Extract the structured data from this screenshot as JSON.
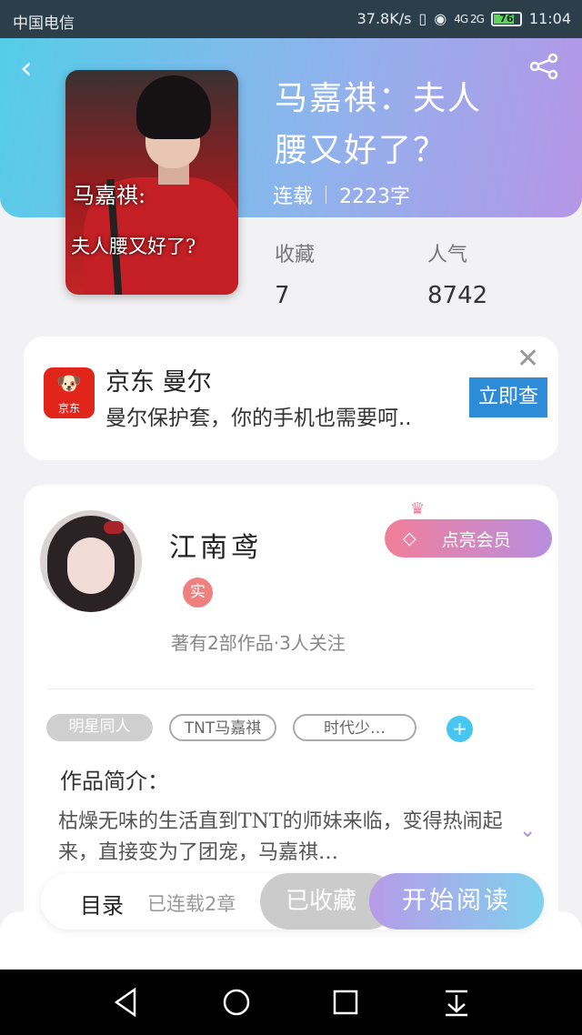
{
  "status_bar": {
    "carrier": "中国电信",
    "net_speed": "37.8K/s",
    "signal": "4G 2G",
    "battery": "76",
    "time": "11:04"
  },
  "header": {
    "gradient": [
      "#55cde8",
      "#b596e6"
    ]
  },
  "book": {
    "title_line1": "马嘉祺：夫人",
    "title_line2": "腰又好了？",
    "status": "连载",
    "words": "2223字",
    "cover_line1": "马嘉祺:",
    "cover_line2": "夫人腰又好了?"
  },
  "stats": {
    "favorites_label": "收藏",
    "favorites_value": "7",
    "popularity_label": "人气",
    "popularity_value": "8742"
  },
  "ad": {
    "logo_text": "京东",
    "title": "京东 曼尔",
    "description": "曼尔保护套，你的手机也需要呵..",
    "button": "立即查"
  },
  "author": {
    "name": "江南鸢",
    "verified_badge": "实",
    "vip_button": "点亮会员",
    "works_info": "著有2部作品·3人关注"
  },
  "tags": [
    "明星同人",
    "TNT马嘉祺",
    "时代少…"
  ],
  "intro": {
    "label": "作品简介：",
    "text": "枯燥无味的生活直到TNT的师妹来临，变得热闹起来，直接变为了团宠，马嘉祺…"
  },
  "bottom": {
    "toc": "目录",
    "chapters": "已连载2章",
    "fav_button": "已收藏",
    "read_button": "开始阅读"
  }
}
